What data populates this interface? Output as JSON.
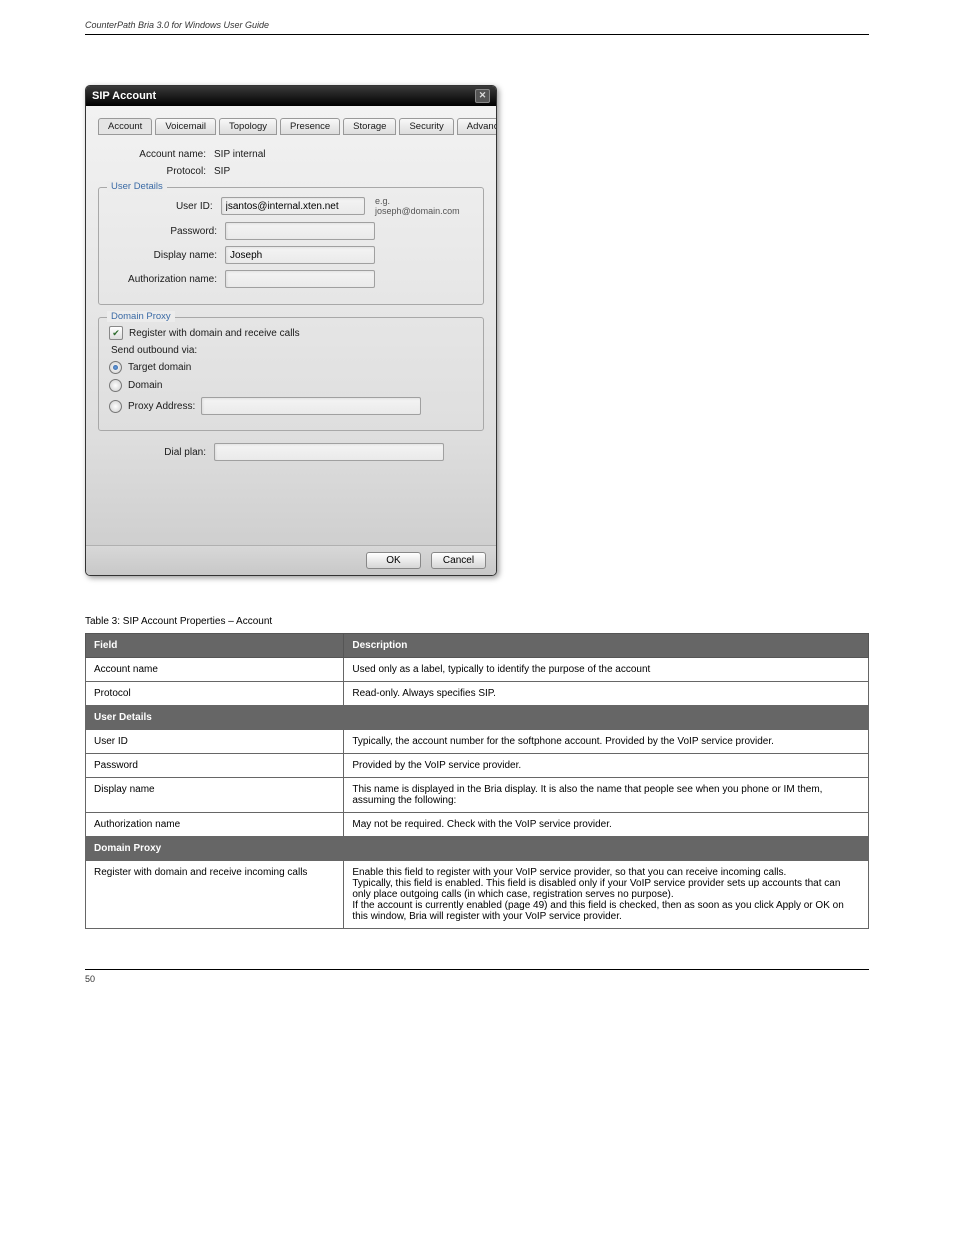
{
  "header": {
    "left": "CounterPath Bria 3.0 for Windows User Guide",
    "right": ""
  },
  "dialog": {
    "title": "SIP Account",
    "tabs": [
      {
        "label": "Account"
      },
      {
        "label": "Voicemail"
      },
      {
        "label": "Topology"
      },
      {
        "label": "Presence"
      },
      {
        "label": "Storage"
      },
      {
        "label": "Security"
      },
      {
        "label": "Advanced"
      }
    ],
    "accountNameLabel": "Account name:",
    "accountNameValue": "SIP internal",
    "protocolLabel": "Protocol:",
    "protocolValue": "SIP",
    "userDetails": {
      "legend": "User Details",
      "userIdLabel": "User ID:",
      "userIdValue": "jsantos@internal.xten.net",
      "userIdHint": "e.g. joseph@domain.com",
      "passwordLabel": "Password:",
      "passwordValue": "",
      "displayNameLabel": "Display name:",
      "displayNameValue": "Joseph",
      "authNameLabel": "Authorization name:",
      "authNameValue": ""
    },
    "domainProxy": {
      "legend": "Domain Proxy",
      "registerCheckboxLabel": "Register with domain and receive calls",
      "sendOutboundLabel": "Send outbound via:",
      "targetDomainLabel": "Target domain",
      "domainLabel": "Domain",
      "proxyAddressLabel": "Proxy   Address:",
      "proxyAddressValue": ""
    },
    "dialPlanLabel": "Dial plan:",
    "dialPlanValue": "",
    "okLabel": "OK",
    "cancelLabel": "Cancel"
  },
  "tableTitle": "Table 3: SIP Account Properties – Account",
  "headers": {
    "field": "Field",
    "description": "Description"
  },
  "rows": [
    {
      "field": "Account name",
      "description": "Used only as a label, typically to identify the purpose of the account"
    },
    {
      "field": "Protocol",
      "description": "Read-only. Always specifies SIP."
    }
  ],
  "sectionUserDetails": "User Details",
  "userDetailRows": [
    {
      "field": "User ID",
      "description": "Typically, the account number for the softphone account. Provided by the VoIP service provider."
    },
    {
      "field": "Password",
      "description": "Provided by the VoIP service provider."
    },
    {
      "field": "Display name",
      "description": "This name is displayed in the Bria display. It is also the name that people see when you phone or IM them, assuming the following:"
    },
    {
      "field": "Authorization name",
      "description": "May not be required. Check with the VoIP service provider."
    }
  ],
  "sectionDomainProxy": "Domain Proxy",
  "domainProxyRows": [
    {
      "field": "Register with domain and receive incoming calls",
      "description": "Enable this field to register with your VoIP service provider, so that you can receive incoming calls.\nTypically, this field is enabled. This field is disabled only if your VoIP service provider sets up accounts that can only place outgoing calls (in which case, registration serves no purpose).\nIf the account is currently enabled (page 49) and this field is checked, then as soon as you click Apply or OK on this window, Bria will register with your VoIP service provider."
    }
  ],
  "footer": {
    "page": "50"
  }
}
